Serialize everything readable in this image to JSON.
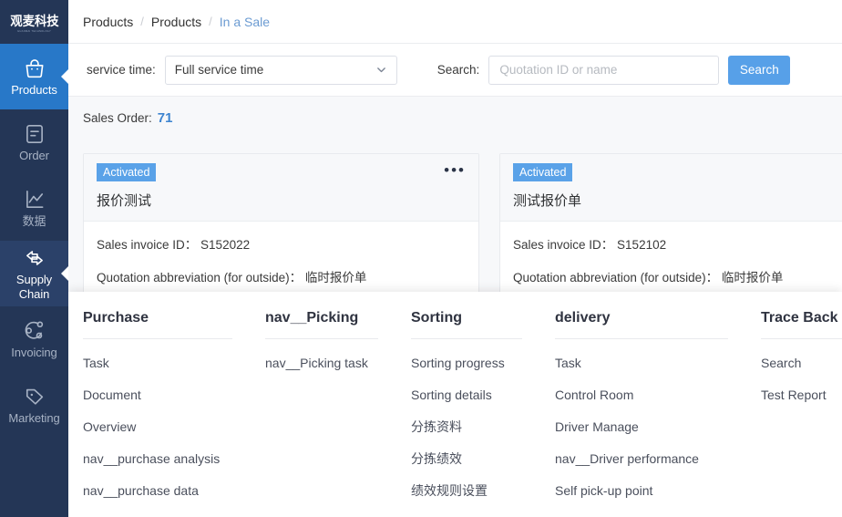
{
  "sidebar": {
    "logo": {
      "cn": "观麦科技",
      "en": "GUANMAI TECHNOLOGY"
    },
    "items": [
      {
        "label": "Products",
        "icon": "basket-icon",
        "state": "active"
      },
      {
        "label": "Order",
        "icon": "document-icon",
        "state": "normal"
      },
      {
        "label": "数据",
        "icon": "chart-line-icon",
        "state": "normal"
      },
      {
        "label": "Supply Chain",
        "icon": "exchange-arrows-icon",
        "state": "active-dim"
      },
      {
        "label": "Invoicing",
        "icon": "share-nodes-icon",
        "state": "normal"
      },
      {
        "label": "Marketing",
        "icon": "tag-icon",
        "state": "normal"
      }
    ]
  },
  "breadcrumb": {
    "items": [
      "Products",
      "Products",
      "In a Sale"
    ],
    "separator": "/"
  },
  "filterbar": {
    "service_time_label": "service time:",
    "service_time_value": "Full service time",
    "search_label": "Search:",
    "search_placeholder": "Quotation ID or name",
    "search_value": "",
    "search_button": "Search"
  },
  "summary": {
    "label": "Sales Order:",
    "count": "71"
  },
  "cards": [
    {
      "badge": "Activated",
      "title": "报价测试",
      "rows": [
        "Sales invoice ID： S152022",
        "Quotation abbreviation (for outside)： 临时报价单"
      ],
      "menu_icon": "ellipsis-icon",
      "menu_glyph": "•••"
    },
    {
      "badge": "Activated",
      "title": "测试报价单",
      "rows": [
        "Sales invoice ID： S152102",
        "Quotation abbreviation (for outside)： 临时报价单"
      ]
    }
  ],
  "megamenu": {
    "columns": [
      {
        "title": "Purchase",
        "links": [
          "Task",
          "Document",
          "Overview",
          "nav__purchase analysis",
          "nav__purchase data"
        ]
      },
      {
        "title": "nav__Picking",
        "links": [
          "nav__Picking task"
        ]
      },
      {
        "title": "Sorting",
        "links": [
          "Sorting progress",
          "Sorting details",
          "分拣资料",
          "分拣绩效",
          "绩效规则设置"
        ]
      },
      {
        "title": "delivery",
        "links": [
          "Task",
          "Control Room",
          "Driver Manage",
          "nav__Driver performance",
          "Self pick-up point"
        ]
      },
      {
        "title": "Trace Back",
        "links": [
          "Search",
          "Test Report"
        ]
      }
    ]
  },
  "colors": {
    "sidebar_bg": "#243656",
    "sidebar_active": "#2878c8",
    "sidebar_active_dim": "#2b4169",
    "accent_blue": "#57a0e8",
    "badge_blue": "#5aa2e8",
    "count_blue": "#3d84d0",
    "panel_bg": "#f7f8fa"
  }
}
